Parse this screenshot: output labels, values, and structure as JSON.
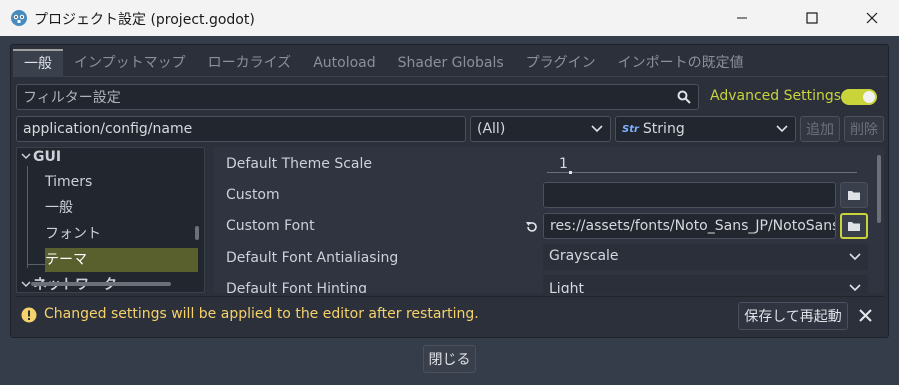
{
  "window": {
    "title": "プロジェクト設定 (project.godot)"
  },
  "tabs": [
    {
      "label": "一般",
      "active": true
    },
    {
      "label": "インプットマップ"
    },
    {
      "label": "ローカライズ"
    },
    {
      "label": "Autoload"
    },
    {
      "label": "Shader Globals"
    },
    {
      "label": "プラグイン"
    },
    {
      "label": "インポートの既定値"
    }
  ],
  "filter": {
    "placeholder": "フィルター設定",
    "advanced_label": "Advanced Settings",
    "advanced_enabled": true
  },
  "add_row": {
    "path_value": "application/config/name",
    "scope_value": "(All)",
    "type_value": "String",
    "add_label": "追加",
    "delete_label": "削除"
  },
  "tree": {
    "items": [
      {
        "label": "GUI",
        "section": true
      },
      {
        "label": "Timers"
      },
      {
        "label": "一般"
      },
      {
        "label": "フォント"
      },
      {
        "label": "テーマ",
        "selected": true
      },
      {
        "label": "ネットワーク",
        "section": true
      }
    ]
  },
  "properties": [
    {
      "label": "Default Theme Scale",
      "value": "1"
    },
    {
      "label": "Custom",
      "value": ""
    },
    {
      "label": "Custom Font",
      "value": "res://assets/fonts/Noto_Sans_JP/NotoSansJ"
    },
    {
      "label": "Default Font Antialiasing",
      "value": "Grayscale"
    },
    {
      "label": "Default Font Hinting",
      "value": "Light"
    }
  ],
  "status": {
    "message": "Changed settings will be applied to the editor after restarting.",
    "restart_label": "保存して再起動"
  },
  "footer": {
    "close_label": "閉じる"
  },
  "colors": {
    "accent": "#c9d43a",
    "warning": "#f6d26a",
    "selected_row": "#5a5f2e"
  }
}
